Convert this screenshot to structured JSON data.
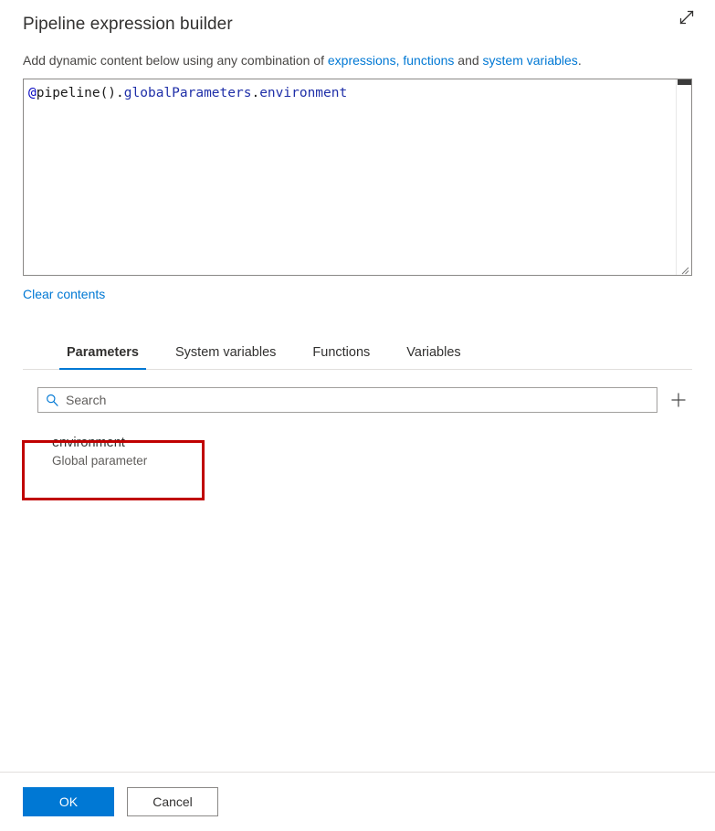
{
  "header": {
    "title": "Pipeline expression builder",
    "expand_icon": "expand-diagonal-icon"
  },
  "description": {
    "lead": "Add dynamic content below using any combination of ",
    "link1": "expressions, functions",
    "middle": " and ",
    "link2": "system variables",
    "trail": "."
  },
  "editor": {
    "expression": "@pipeline().globalParameters.environment",
    "tokens": [
      {
        "text": "@",
        "kind": "at"
      },
      {
        "text": "pipeline",
        "kind": "plain"
      },
      {
        "text": "().",
        "kind": "punct"
      },
      {
        "text": "globalParameters",
        "kind": "prop"
      },
      {
        "text": ".",
        "kind": "punct"
      },
      {
        "text": "environment",
        "kind": "prop"
      }
    ],
    "scrollbar_present": true,
    "resize_handle": "resize-grip-icon"
  },
  "clear_contents_label": "Clear contents",
  "tabs": [
    {
      "label": "Parameters",
      "active": true
    },
    {
      "label": "System variables",
      "active": false
    },
    {
      "label": "Functions",
      "active": false
    },
    {
      "label": "Variables",
      "active": false
    }
  ],
  "search": {
    "placeholder": "Search",
    "value": "",
    "icon": "search-icon",
    "add_icon": "plus-icon"
  },
  "parameters": [
    {
      "name": "environment",
      "subtitle": "Global parameter",
      "highlighted": true
    }
  ],
  "footer": {
    "ok_label": "OK",
    "cancel_label": "Cancel"
  },
  "colors": {
    "accent": "#0078d4",
    "link": "#0078d4",
    "annotation": "#c00000",
    "text": "#323130",
    "muted": "#605e5c",
    "token_at": "#0000c0",
    "token_property": "#1f2fa8"
  }
}
